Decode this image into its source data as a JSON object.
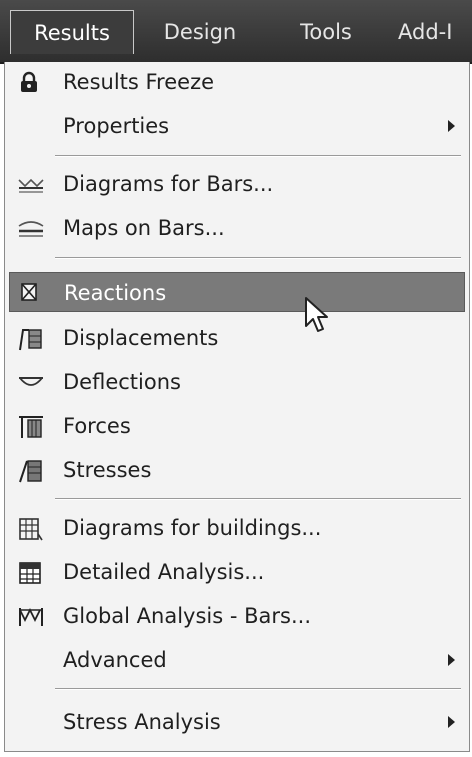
{
  "menubar": {
    "tabs": [
      {
        "label": "Results"
      },
      {
        "label": "Design"
      },
      {
        "label": "Tools"
      },
      {
        "label": "Add-I"
      }
    ]
  },
  "menu": {
    "items": [
      {
        "label": "Results Freeze",
        "icon": "lock-icon"
      },
      {
        "label": "Properties",
        "icon": "",
        "submenu": true
      },
      {
        "label": "Diagrams for Bars...",
        "icon": "bar-diagram-icon"
      },
      {
        "label": "Maps on Bars...",
        "icon": "bar-map-icon"
      },
      {
        "label": "Reactions",
        "icon": "reactions-icon",
        "highlighted": true
      },
      {
        "label": "Displacements",
        "icon": "displacements-icon"
      },
      {
        "label": "Deflections",
        "icon": "deflections-icon"
      },
      {
        "label": "Forces",
        "icon": "forces-icon"
      },
      {
        "label": "Stresses",
        "icon": "stresses-icon"
      },
      {
        "label": "Diagrams for buildings...",
        "icon": "building-diagram-icon"
      },
      {
        "label": "Detailed Analysis...",
        "icon": "detailed-analysis-icon"
      },
      {
        "label": "Global Analysis - Bars...",
        "icon": "global-analysis-icon"
      },
      {
        "label": "Advanced",
        "icon": "",
        "submenu": true
      },
      {
        "label": "Stress Analysis",
        "icon": "",
        "submenu": true
      }
    ]
  },
  "colors": {
    "menubar_bg": "#3a3a3a",
    "menu_bg": "#f3f3f3",
    "highlight_bg": "#7a7a7a"
  }
}
